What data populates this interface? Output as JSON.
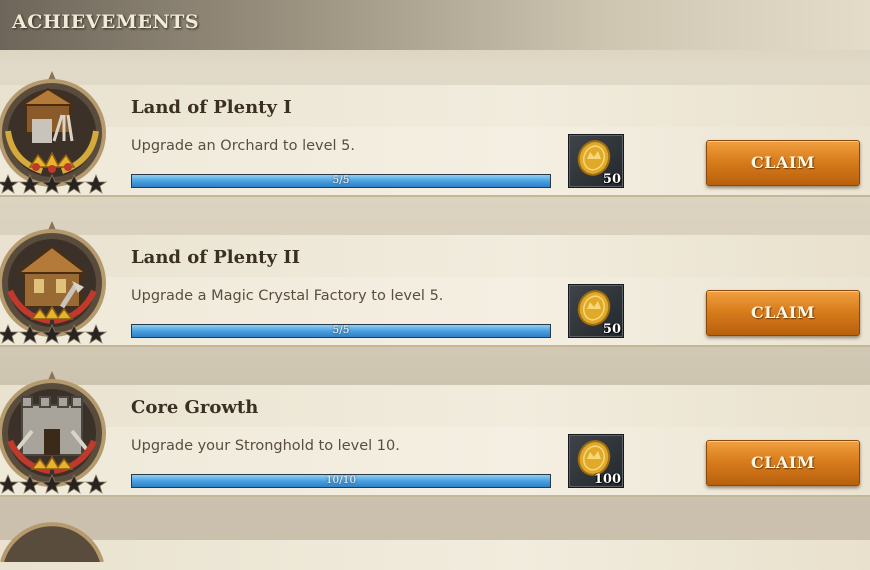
{
  "header": {
    "title": "ACHIEVEMENTS"
  },
  "achievements": [
    {
      "name": "Land of Plenty I",
      "description": "Upgrade an Orchard to level 5.",
      "progress_text": "5/5",
      "progress_fraction": 1.0,
      "reward_icon": "gold-coin-icon",
      "reward_amount": "50",
      "claim_label": "CLAIM",
      "badge_icon": "orchard-building-icon",
      "stars_total": 5
    },
    {
      "name": "Land of Plenty II",
      "description": "Upgrade a Magic Crystal Factory to level 5.",
      "progress_text": "5/5",
      "progress_fraction": 1.0,
      "reward_icon": "gold-coin-icon",
      "reward_amount": "50",
      "claim_label": "CLAIM",
      "badge_icon": "crystal-factory-icon",
      "stars_total": 5
    },
    {
      "name": "Core Growth",
      "description": "Upgrade your Stronghold to level 10.",
      "progress_text": "10/10",
      "progress_fraction": 1.0,
      "reward_icon": "gold-coin-icon",
      "reward_amount": "100",
      "claim_label": "CLAIM",
      "badge_icon": "stronghold-icon",
      "stars_total": 5
    }
  ],
  "partial_item": {
    "name": ""
  },
  "colors": {
    "claim_button": "#d97d1c",
    "progress_fill": "#4aa0df",
    "title_text": "#f2ead6"
  }
}
